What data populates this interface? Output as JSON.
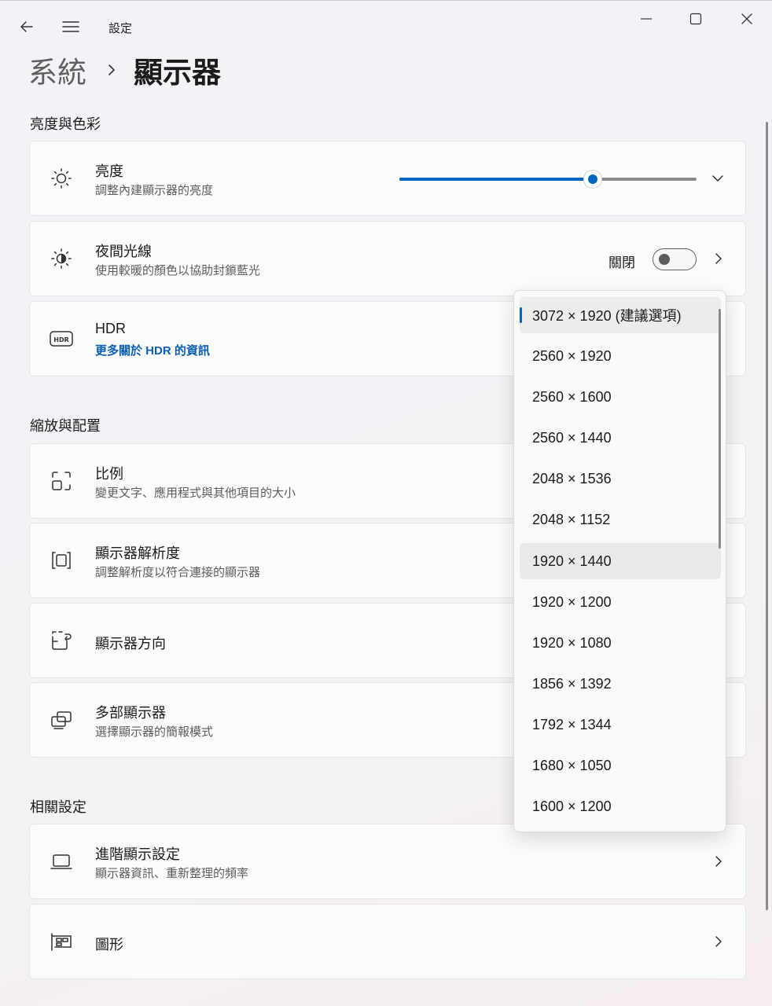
{
  "app": {
    "title": "設定"
  },
  "breadcrumb": {
    "parent": "系統",
    "current": "顯示器"
  },
  "sections": {
    "brightness_color": "亮度與色彩",
    "scale_layout": "縮放與配置",
    "related": "相關設定"
  },
  "brightness": {
    "title": "亮度",
    "subtitle": "調整內建顯示器的亮度",
    "level_percent": 65
  },
  "night_light": {
    "title": "夜間光線",
    "subtitle": "使用較暖的顏色以協助封鎖藍光",
    "state_label": "關閉",
    "on": false
  },
  "hdr": {
    "title": "HDR",
    "link": "更多關於 HDR 的資訊"
  },
  "scale": {
    "title": "比例",
    "subtitle": "變更文字、應用程式與其他項目的大小"
  },
  "resolution": {
    "title": "顯示器解析度",
    "subtitle": "調整解析度以符合連接的顯示器"
  },
  "orientation": {
    "title": "顯示器方向"
  },
  "multiple": {
    "title": "多部顯示器",
    "subtitle": "選擇顯示器的簡報模式"
  },
  "advanced": {
    "title": "進階顯示設定",
    "subtitle": "顯示器資訊、重新整理的頻率"
  },
  "graphics": {
    "title": "圖形"
  },
  "resolution_options": [
    "3072 × 1920 (建議選項)",
    "2560 × 1920",
    "2560 × 1600",
    "2560 × 1440",
    "2048 × 1536",
    "2048 × 1152",
    "1920 × 1440",
    "1920 × 1200",
    "1920 × 1080",
    "1856 × 1392",
    "1792 × 1344",
    "1680 × 1050",
    "1600 × 1200"
  ],
  "colors": {
    "accent": "#0067c0"
  }
}
